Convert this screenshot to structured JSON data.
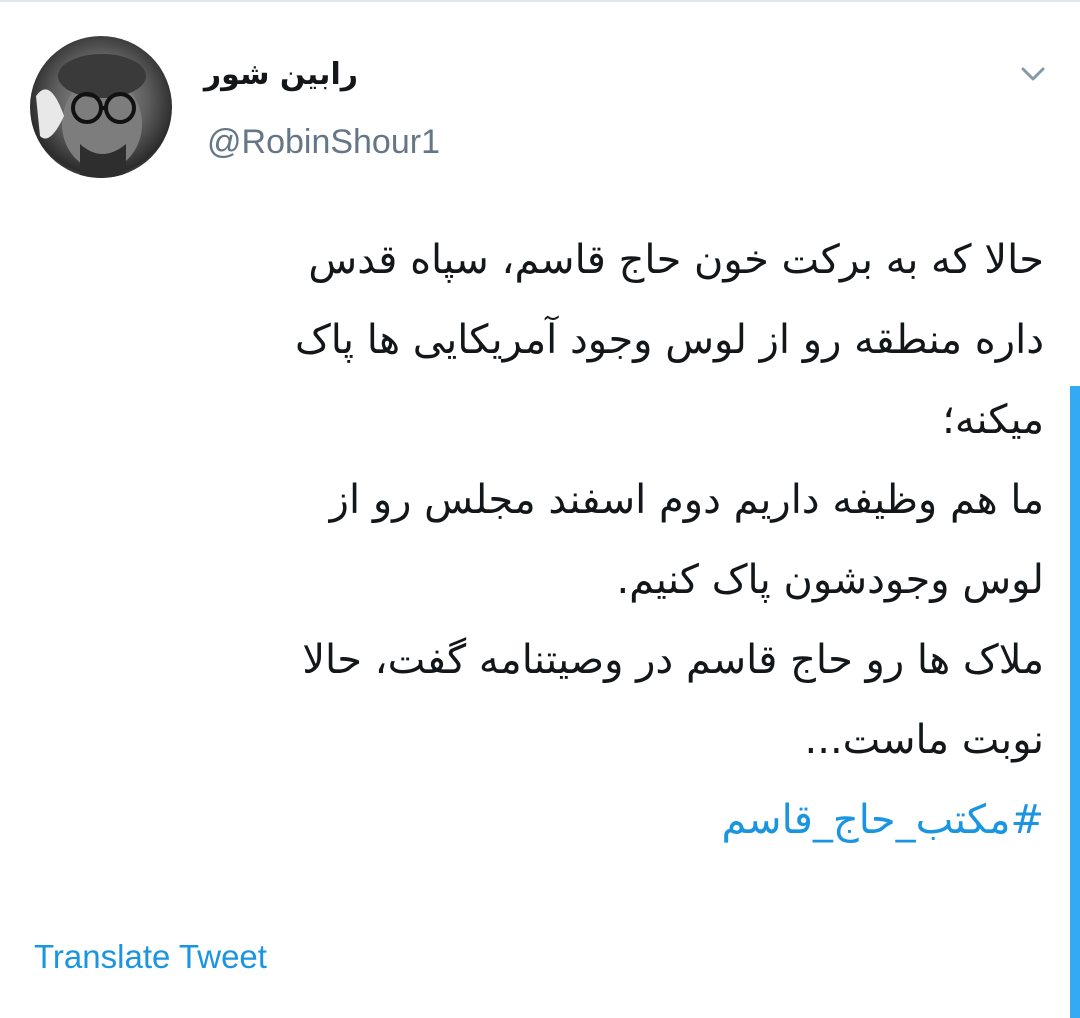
{
  "tweet": {
    "author": {
      "display_name": "رابین شور",
      "handle": "@RobinShour1",
      "avatar_icon": "portrait-avatar"
    },
    "menu_icon": "chevron-down-icon",
    "lines": [
      "حالا که به برکت خون حاج قاسم، سپاه قدس",
      "داره منطقه رو از لوس وجود آمریکایی ها پاک",
      "میکنه؛",
      "ما هم وظیفه داریم دوم اسفند مجلس رو از",
      "لوس وجودشون پاک کنیم.",
      "ملاک ها رو حاج قاسم در وصیتنامه گفت، حالا",
      "نوبت ماست..."
    ],
    "hashtag": "#مکتب_حاج_قاسم",
    "translate_label": "Translate Tweet"
  },
  "colors": {
    "text": "#14171a",
    "secondary": "#657786",
    "link": "#1b95e0",
    "divider": "#e1e8ed"
  }
}
